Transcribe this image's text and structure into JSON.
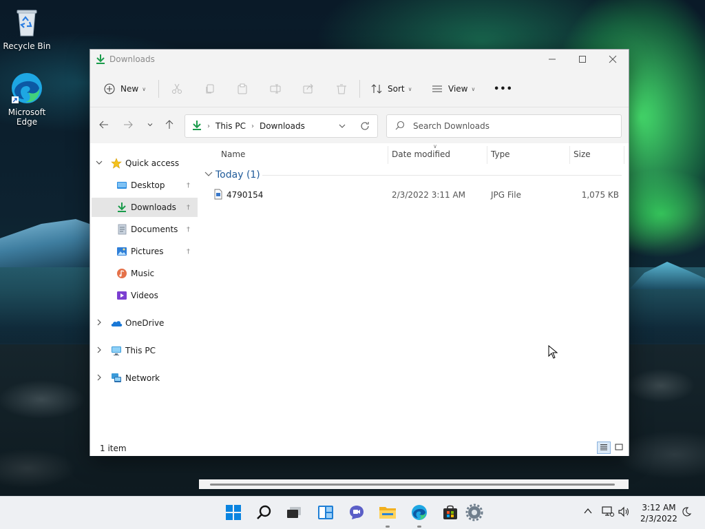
{
  "desktop": {
    "icons": [
      {
        "label": "Recycle Bin",
        "icon": "recycle-bin-icon"
      },
      {
        "label": "Microsoft Edge",
        "line1": "Microsoft",
        "line2": "Edge",
        "icon": "edge-icon"
      }
    ]
  },
  "window": {
    "title": "Downloads",
    "controls": {
      "minimize": "minimize-icon",
      "maximize": "maximize-icon",
      "close": "close-icon"
    }
  },
  "toolbar": {
    "new_label": "New",
    "sort_label": "Sort",
    "view_label": "View",
    "more_label": "•••",
    "icons": [
      "cut-icon",
      "copy-icon",
      "paste-icon",
      "rename-icon",
      "share-icon",
      "delete-icon"
    ]
  },
  "address": {
    "crumbs": [
      "This PC",
      "Downloads"
    ],
    "search_placeholder": "Search Downloads"
  },
  "sidebar": {
    "quick_access": "Quick access",
    "items": [
      {
        "label": "Desktop",
        "pinned": true,
        "icon": "desktop-folder-icon"
      },
      {
        "label": "Downloads",
        "pinned": true,
        "selected": true,
        "icon": "downloads-folder-icon"
      },
      {
        "label": "Documents",
        "pinned": true,
        "icon": "documents-folder-icon"
      },
      {
        "label": "Pictures",
        "pinned": true,
        "icon": "pictures-folder-icon"
      },
      {
        "label": "Music",
        "pinned": false,
        "icon": "music-folder-icon"
      },
      {
        "label": "Videos",
        "pinned": false,
        "icon": "videos-folder-icon"
      }
    ],
    "onedrive": "OneDrive",
    "this_pc": "This PC",
    "network": "Network"
  },
  "columns": {
    "name": "Name",
    "date_modified": "Date modified",
    "type": "Type",
    "size": "Size"
  },
  "group": {
    "label": "Today (1)"
  },
  "files": [
    {
      "name": "4790154",
      "date_modified": "2/3/2022 3:11 AM",
      "type": "JPG File",
      "size": "1,075 KB"
    }
  ],
  "status": {
    "count": "1 item"
  },
  "taskbar": {
    "apps": [
      "start-icon",
      "search-icon",
      "task-view-icon",
      "widgets-icon",
      "chat-icon",
      "file-explorer-icon",
      "edge-icon",
      "store-icon",
      "settings-icon"
    ],
    "time": "3:12 AM",
    "date": "2/3/2022"
  },
  "colors": {
    "accent": "#0067c0",
    "selection": "#e5e5e5",
    "group_header": "#1f5a99"
  }
}
